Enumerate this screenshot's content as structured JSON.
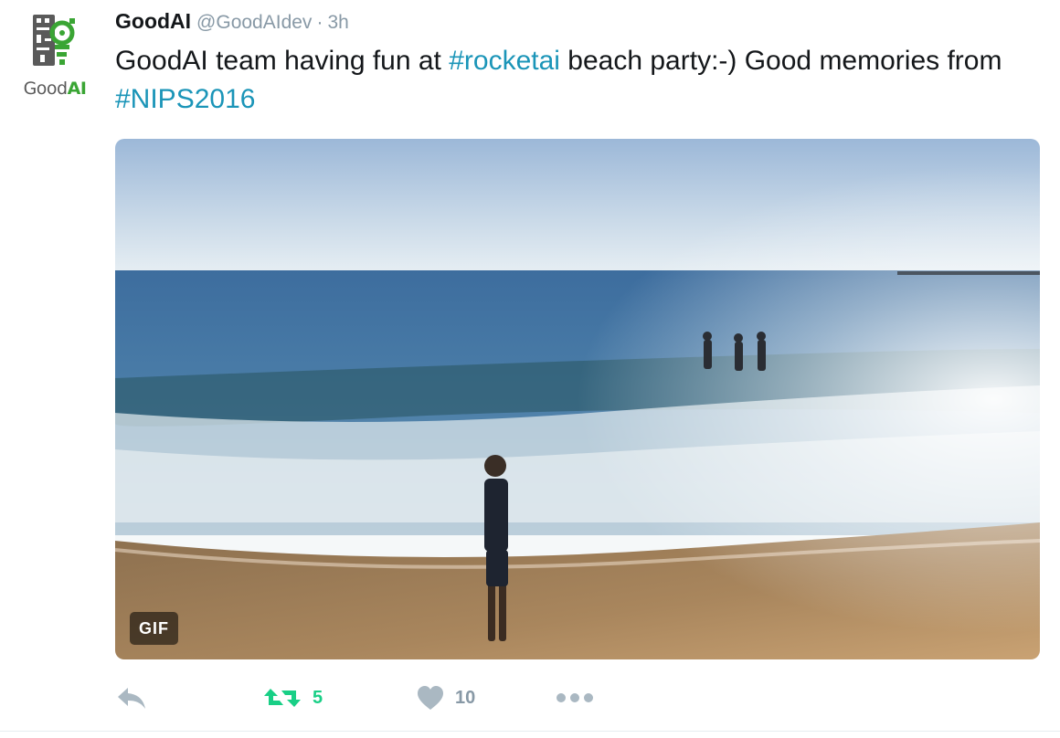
{
  "author": {
    "display_name": "GoodAI",
    "handle": "@GoodAIdev",
    "separator": "·",
    "time": "3h",
    "avatar": {
      "wordmark_good": "Good",
      "wordmark_ai": "AI",
      "brand_color": "#3aa534"
    }
  },
  "tweet": {
    "segments": [
      {
        "text": "GoodAI team having fun at ",
        "type": "plain"
      },
      {
        "text": "#rocketai",
        "type": "hashtag"
      },
      {
        "text": " beach party:-) Good memories from ",
        "type": "plain"
      },
      {
        "text": "#NIPS2016",
        "type": "hashtag"
      }
    ],
    "hashtag_color": "#1b95b8"
  },
  "media": {
    "badge": "GIF"
  },
  "actions": {
    "reply": {
      "icon": "reply-icon"
    },
    "retweet": {
      "icon": "retweet-icon",
      "count": "5",
      "color": "#19cf86"
    },
    "like": {
      "icon": "heart-icon",
      "count": "10"
    },
    "more": {
      "icon": "more-icon"
    }
  }
}
